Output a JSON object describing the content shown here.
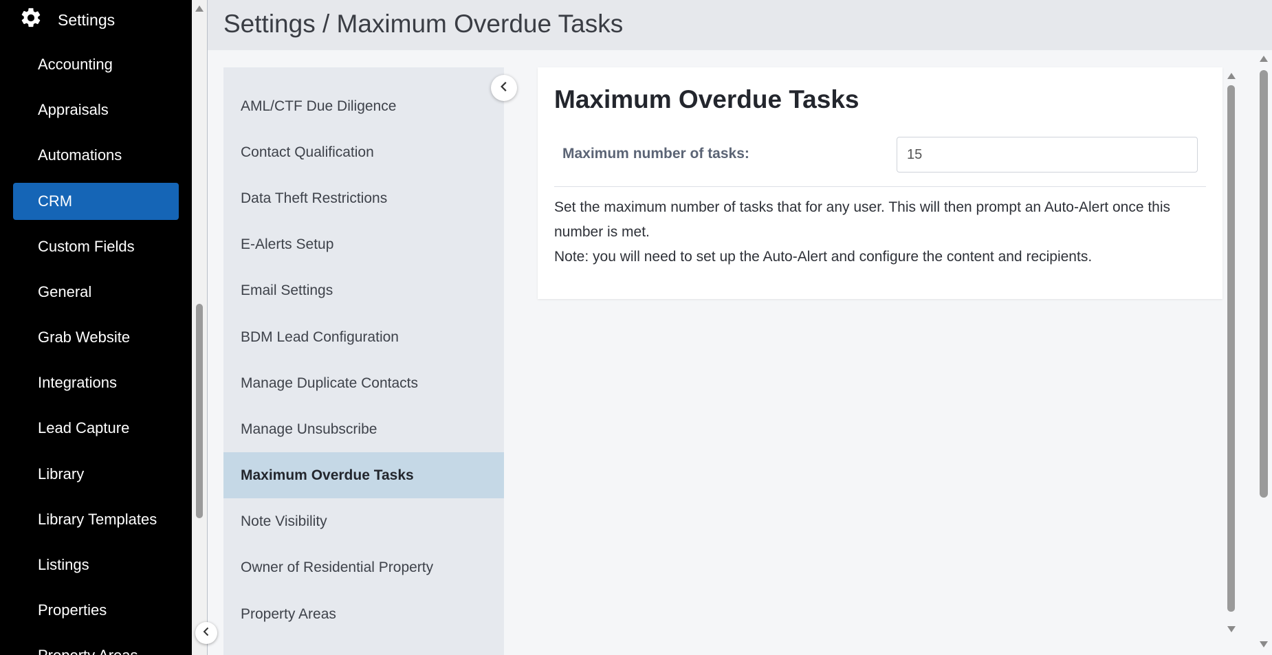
{
  "sidebar": {
    "header_label": "Settings",
    "header_icon": "gear-icon",
    "items": [
      {
        "label": "Accounting",
        "active": false
      },
      {
        "label": "Appraisals",
        "active": false
      },
      {
        "label": "Automations",
        "active": false
      },
      {
        "label": "CRM",
        "active": true
      },
      {
        "label": "Custom Fields",
        "active": false
      },
      {
        "label": "General",
        "active": false
      },
      {
        "label": "Grab Website",
        "active": false
      },
      {
        "label": "Integrations",
        "active": false
      },
      {
        "label": "Lead Capture",
        "active": false
      },
      {
        "label": "Library",
        "active": false
      },
      {
        "label": "Library Templates",
        "active": false
      },
      {
        "label": "Listings",
        "active": false
      },
      {
        "label": "Properties",
        "active": false
      },
      {
        "label": "Property Areas",
        "active": false
      }
    ],
    "active_color": "#1565b6"
  },
  "header": {
    "title": "Settings / Maximum Overdue Tasks"
  },
  "subnav": {
    "items": [
      {
        "label": "AML/CTF Due Diligence",
        "active": false
      },
      {
        "label": "Contact Qualification",
        "active": false
      },
      {
        "label": "Data Theft Restrictions",
        "active": false
      },
      {
        "label": "E-Alerts Setup",
        "active": false
      },
      {
        "label": "Email Settings",
        "active": false
      },
      {
        "label": "BDM Lead Configuration",
        "active": false
      },
      {
        "label": "Manage Duplicate Contacts",
        "active": false
      },
      {
        "label": "Manage Unsubscribe",
        "active": false
      },
      {
        "label": "Maximum Overdue Tasks",
        "active": true
      },
      {
        "label": "Note Visibility",
        "active": false
      },
      {
        "label": "Owner of Residential Property",
        "active": false
      },
      {
        "label": "Property Areas",
        "active": false
      }
    ]
  },
  "main": {
    "heading": "Maximum Overdue Tasks",
    "field_label": "Maximum number of tasks:",
    "field_value": "15",
    "description_line1": "Set the maximum number of tasks that for any user. This will then prompt an Auto-Alert once this number is met.",
    "description_line2": "Note: you will need to set up the Auto-Alert and configure the content and recipients."
  }
}
